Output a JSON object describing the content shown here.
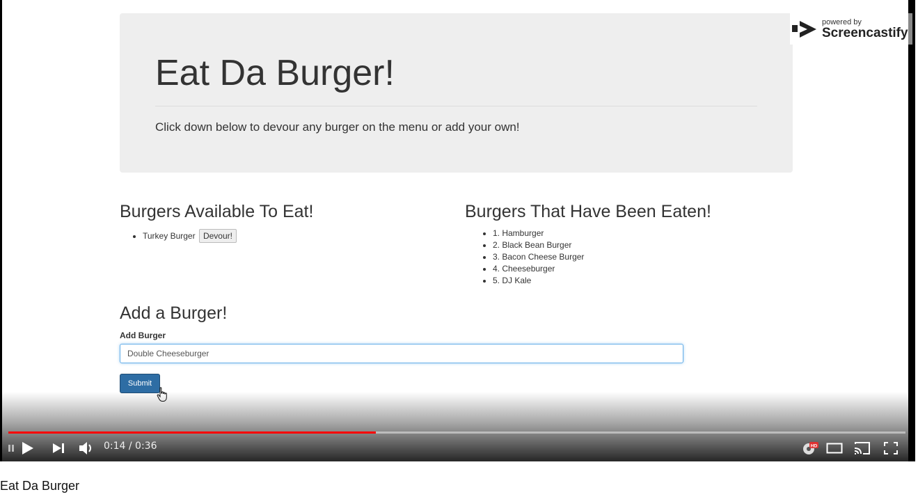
{
  "page": {
    "heading": "Eat Da Burger!",
    "subtitle": "Click down below to devour any burger on the menu or add your own!"
  },
  "available": {
    "title": "Burgers Available To Eat!",
    "items": [
      {
        "name": "Turkey Burger",
        "button": "Devour!"
      }
    ]
  },
  "eaten": {
    "title": "Burgers That Have Been Eaten!",
    "items": [
      "1. Hamburger",
      "2. Black Bean Burger",
      "3. Bacon Cheese Burger",
      "4. Cheeseburger",
      "5. DJ Kale"
    ]
  },
  "add_form": {
    "title": "Add a Burger!",
    "label": "Add Burger",
    "input_value": "Double Cheeseburger",
    "submit_label": "Submit"
  },
  "watermark": {
    "powered_by": "powered by",
    "brand": "Screencastify"
  },
  "player": {
    "time": "0:14 / 0:36",
    "progress_fraction": 0.41,
    "progress_color": "#ff0000",
    "hd_badge": "HD"
  },
  "video_title": "Eat Da Burger"
}
